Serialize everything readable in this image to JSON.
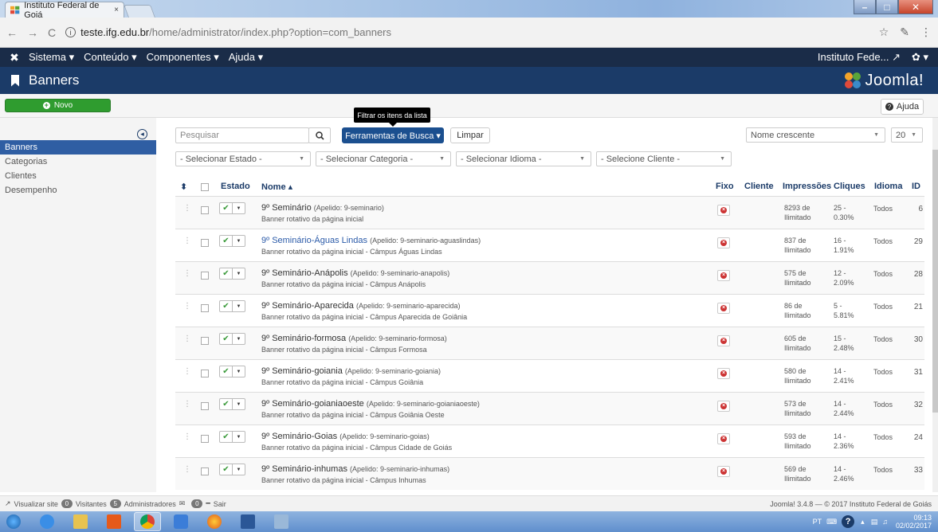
{
  "browser": {
    "tab_title": "Instituto Federal de Goiá",
    "tab_close": "×",
    "url_host": "teste.ifg.edu.br",
    "url_path": "/home/administrator/index.php?option=com_banners",
    "back": "←",
    "forward": "→",
    "reload": "C",
    "star": "☆"
  },
  "navbar": {
    "menus": [
      "Sistema ▾",
      "Conteúdo ▾",
      "Componentes ▾",
      "Ajuda ▾"
    ],
    "site": "Instituto Fede... ↗",
    "gear": "✿ ▾"
  },
  "header": {
    "title": "Banners",
    "logo_text": "Joomla!"
  },
  "toolbar": {
    "novo": "Novo",
    "ajuda": "Ajuda",
    "tooltip": "Filtrar os itens da lista"
  },
  "sidebar": {
    "items": [
      "Banners",
      "Categorias",
      "Clientes",
      "Desempenho"
    ]
  },
  "filters": {
    "search_placeholder": "Pesquisar",
    "ferramentas": "Ferramentas de Busca ▾",
    "limpar": "Limpar",
    "order": "Nome crescente",
    "limit": "20",
    "estado": "- Selecionar Estado -",
    "categoria": "- Selecionar Categoria -",
    "idioma": "- Selecionar Idioma -",
    "cliente": "- Selecione Cliente -"
  },
  "table": {
    "headers": {
      "sort": "⬍",
      "estado": "Estado",
      "nome": "Nome ▴",
      "fixo": "Fixo",
      "cliente": "Cliente",
      "impressoes": "Impressões",
      "cliques": "Cliques",
      "idioma": "Idioma",
      "id": "ID"
    },
    "rows": [
      {
        "name": "9º Seminário",
        "alias": "(Apelido: 9-seminario)",
        "desc": "Banner rotativo da página inicial",
        "imp1": "8293 de",
        "imp2": "Ilimitado",
        "clq1": "25 -",
        "clq2": "0.30%",
        "lang": "Todos",
        "id": "6",
        "link": false
      },
      {
        "name": "9º Seminário-Águas Lindas",
        "alias": "(Apelido: 9-seminario-aguaslindas)",
        "desc": "Banner rotativo da página inicial - Câmpus Águas Lindas",
        "imp1": "837 de",
        "imp2": "Ilimitado",
        "clq1": "16 -",
        "clq2": "1.91%",
        "lang": "Todos",
        "id": "29",
        "link": true
      },
      {
        "name": "9º Seminário-Anápolis",
        "alias": "(Apelido: 9-seminario-anapolis)",
        "desc": "Banner rotativo da página inicial - Câmpus Anápolis",
        "imp1": "575 de",
        "imp2": "Ilimitado",
        "clq1": "12 -",
        "clq2": "2.09%",
        "lang": "Todos",
        "id": "28",
        "link": false
      },
      {
        "name": "9º Seminário-Aparecida",
        "alias": "(Apelido: 9-seminario-aparecida)",
        "desc": "Banner rotativo da página inicial - Câmpus Aparecida de Goiânia",
        "imp1": "86 de",
        "imp2": "Ilimitado",
        "clq1": "5 -",
        "clq2": "5.81%",
        "lang": "Todos",
        "id": "21",
        "link": false
      },
      {
        "name": "9º Seminário-formosa",
        "alias": "(Apelido: 9-seminario-formosa)",
        "desc": "Banner rotativo da página inicial - Câmpus Formosa",
        "imp1": "605 de",
        "imp2": "Ilimitado",
        "clq1": "15 -",
        "clq2": "2.48%",
        "lang": "Todos",
        "id": "30",
        "link": false
      },
      {
        "name": "9º Seminário-goiania",
        "alias": "(Apelido: 9-seminario-goiania)",
        "desc": "Banner rotativo da página inicial - Câmpus Goiânia",
        "imp1": "580 de",
        "imp2": "Ilimitado",
        "clq1": "14 -",
        "clq2": "2.41%",
        "lang": "Todos",
        "id": "31",
        "link": false
      },
      {
        "name": "9º Seminário-goianiaoeste",
        "alias": "(Apelido: 9-seminario-goianiaoeste)",
        "desc": "Banner rotativo da página inicial - Câmpus Goiânia Oeste",
        "imp1": "573 de",
        "imp2": "Ilimitado",
        "clq1": "14 -",
        "clq2": "2.44%",
        "lang": "Todos",
        "id": "32",
        "link": false
      },
      {
        "name": "9º Seminário-Goias",
        "alias": "(Apelido: 9-seminario-goias)",
        "desc": "Banner rotativo da página inicial - Câmpus Cidade de Goiás",
        "imp1": "593 de",
        "imp2": "Ilimitado",
        "clq1": "14 -",
        "clq2": "2.36%",
        "lang": "Todos",
        "id": "24",
        "link": false
      },
      {
        "name": "9º Seminário-inhumas",
        "alias": "(Apelido: 9-seminario-inhumas)",
        "desc": "Banner rotativo da página inicial - Câmpus Inhumas",
        "imp1": "569 de",
        "imp2": "Ilimitado",
        "clq1": "14 -",
        "clq2": "2.46%",
        "lang": "Todos",
        "id": "33",
        "link": false
      }
    ]
  },
  "status": {
    "visualizar": "Visualizar site",
    "visitantes_count": "0",
    "visitantes": "Visitantes",
    "admins_count": "5",
    "admins": "Administradores",
    "msgs_count": "0",
    "sair": "Sair",
    "footer": "Joomla! 3.4.8 — © 2017 Instituto Federal de Goiás"
  },
  "taskbar": {
    "lang": "PT",
    "time": "09:13",
    "date": "02/02/2017"
  },
  "colors": {
    "navbar": "#1a2c48",
    "header": "#1b3b68",
    "novo": "#2f9c2f",
    "active": "#2f5ea3"
  }
}
